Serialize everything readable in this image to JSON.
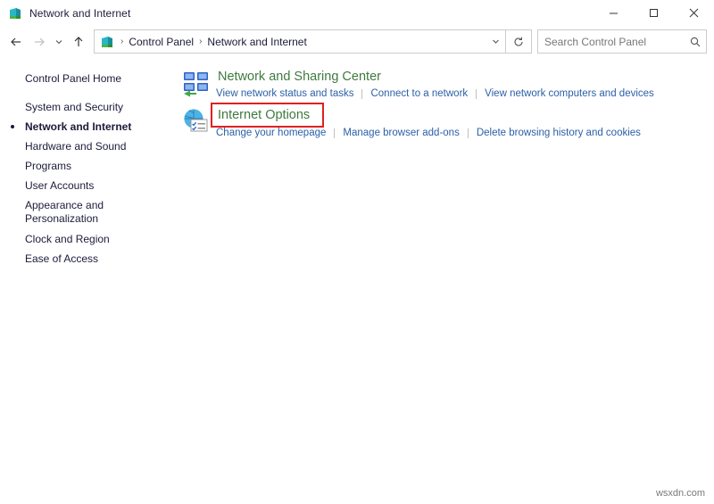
{
  "window": {
    "title": "Network and Internet",
    "title_icon": "network-folder-icon",
    "minimize_label": "─",
    "maximize_label": "□",
    "close_label": "✕"
  },
  "nav": {
    "back_label": "←",
    "forward_label": "→",
    "recent_label": "∨",
    "up_label": "↑",
    "refresh_label": "↻",
    "dropdown_label": "∨",
    "breadcrumb_icon": "network-folder-icon",
    "breadcrumbs": [
      {
        "label": "Control Panel"
      },
      {
        "label": "Network and Internet"
      }
    ],
    "separator": "›"
  },
  "search": {
    "placeholder": "Search Control Panel",
    "value": "",
    "icon": "search-icon"
  },
  "sidebar": {
    "items": [
      {
        "label": "Control Panel Home",
        "selected": false,
        "gap": false
      },
      {
        "label": "System and Security",
        "selected": false,
        "gap": true
      },
      {
        "label": "Network and Internet",
        "selected": true,
        "gap": false
      },
      {
        "label": "Hardware and Sound",
        "selected": false,
        "gap": false
      },
      {
        "label": "Programs",
        "selected": false,
        "gap": false
      },
      {
        "label": "User Accounts",
        "selected": false,
        "gap": false
      },
      {
        "label": "Appearance and Personalization",
        "selected": false,
        "gap": false
      },
      {
        "label": "Clock and Region",
        "selected": false,
        "gap": false
      },
      {
        "label": "Ease of Access",
        "selected": false,
        "gap": false
      }
    ]
  },
  "main": {
    "groups": [
      {
        "title": "Network and Sharing Center",
        "icon": "network-sharing-center-icon",
        "highlighted": false,
        "links": [
          "View network status and tasks",
          "Connect to a network",
          "View network computers and devices"
        ]
      },
      {
        "title": "Internet Options",
        "icon": "internet-options-icon",
        "highlighted": true,
        "links": [
          "Change your homepage",
          "Manage browser add-ons",
          "Delete browsing history and cookies"
        ]
      }
    ]
  },
  "watermark": {
    "text": "wsxdn.com"
  },
  "colors": {
    "heading_green": "#3f7a3f",
    "link_blue": "#2b5fa8",
    "highlight_red": "#e02020",
    "text": "#1b1b3a"
  }
}
